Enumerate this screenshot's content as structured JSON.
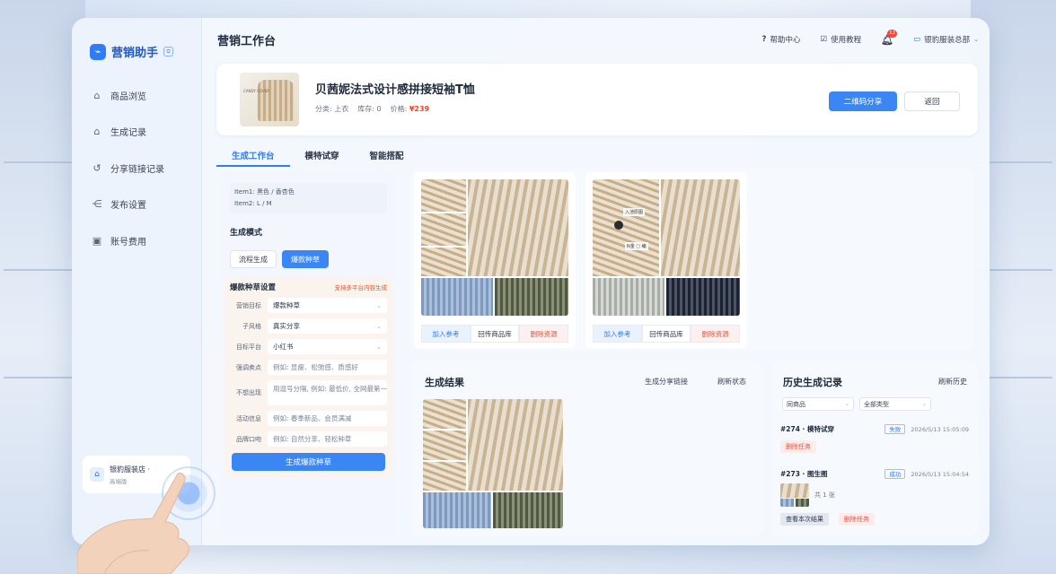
{
  "sidebar": {
    "logo_text": "营销助手",
    "logo_tag": "⧉",
    "items": [
      {
        "label": "商品浏览",
        "icon": "home-icon"
      },
      {
        "label": "生成记录",
        "icon": "home-icon"
      },
      {
        "label": "分享链接记录",
        "icon": "share-icon"
      },
      {
        "label": "发布设置",
        "icon": "share-node-icon"
      },
      {
        "label": "账号费用",
        "icon": "bill-icon"
      }
    ],
    "store_name": "银豹服装店 ·",
    "store_sub": "高端版"
  },
  "header": {
    "title": "营销工作台",
    "help": "帮助中心",
    "tutorial": "使用教程",
    "notify_count": "12",
    "account": "银豹服装总部"
  },
  "product": {
    "name": "贝茜妮法式设计感拼接短袖T恤",
    "category_label": "分类:",
    "category": "上衣",
    "stock_label": "库存:",
    "stock": "0",
    "price_label": "价格:",
    "price": "¥239",
    "img_label": "CANDY COVER",
    "share_btn": "二维码分享",
    "back_btn": "返回"
  },
  "tabs": [
    "生成工作台",
    "模特试穿",
    "智能搭配"
  ],
  "workbench": {
    "item1": "Item1: 黑色 / 香杏色",
    "item2": "Item2: L / M",
    "mode_title": "生成模式",
    "mode_a": "流程生成",
    "mode_b": "爆款种草",
    "settings_title": "爆款种草设置",
    "settings_hint": "支持多平台内容生成",
    "fields": [
      {
        "key": "营销目标",
        "value": "爆款种草",
        "ph": false
      },
      {
        "key": "子风格",
        "value": "真实分享",
        "ph": false
      },
      {
        "key": "目标平台",
        "value": "小红书",
        "ph": false
      },
      {
        "key": "强调卖点",
        "value": "例如: 显瘦、松弛感、质感好",
        "ph": true
      },
      {
        "key": "不想出现",
        "value": "用逗号分隔, 例如: 最低价, 全网最第一",
        "ph": true
      },
      {
        "key": "活动信息",
        "value": "例如: 春季新品、会员满减",
        "ph": true
      },
      {
        "key": "品牌口吻",
        "value": "例如: 自然分享、轻松种草",
        "ph": true
      }
    ],
    "generate_btn": "生成爆款种草"
  },
  "ref_cards": [
    {
      "add": "加入参考",
      "back": "回传商品库",
      "del": "删除资源",
      "tag": ""
    },
    {
      "add": "加入参考",
      "back": "回传商品库",
      "del": "删除资源",
      "tag": "入池原图",
      "tag2": "N金 ▢ 编"
    }
  ],
  "result": {
    "title": "生成结果",
    "share_link": "生成分享链接",
    "refresh": "刷新状态"
  },
  "history": {
    "title": "历史生成记录",
    "refresh": "刷新历史",
    "filter1": "同商品",
    "filter2": "全部类型",
    "records": [
      {
        "title": "#274 · 模特试穿",
        "status": "失败",
        "time": "2026/5/13 15:05:09",
        "btn1": "删除任务"
      },
      {
        "title": "#273 · 图生图",
        "status": "成功",
        "time": "2026/5/13 15:04:54",
        "count": "共 1 张",
        "btn1": "查看本次结果",
        "btn2": "删除任务"
      }
    ]
  }
}
